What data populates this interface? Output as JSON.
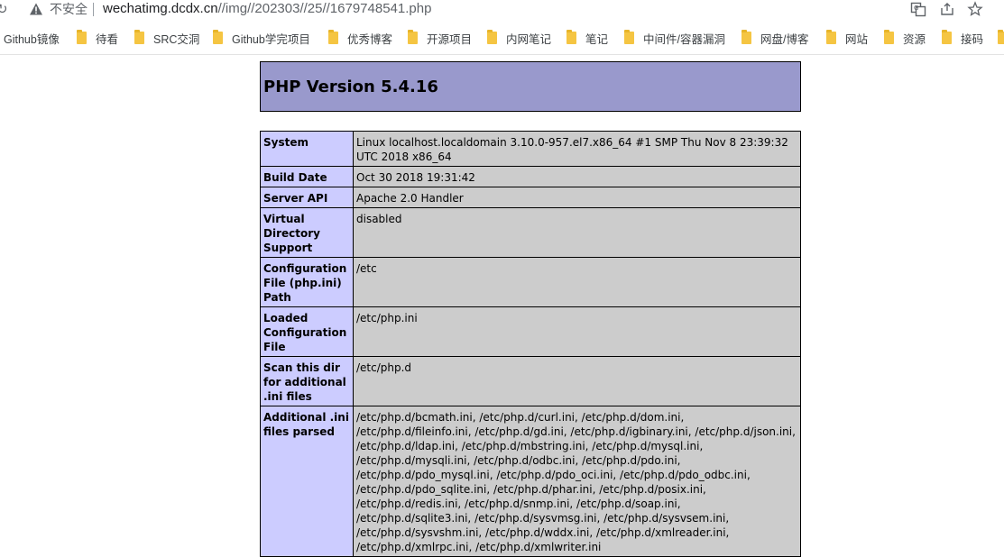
{
  "browser": {
    "insecure_label": "不安全",
    "url_host": "wechatimg.dcdx.cn",
    "url_path": "//img//202303//25//1679748541.php"
  },
  "bookmarks": [
    {
      "label": "Github镜像"
    },
    {
      "label": "待看"
    },
    {
      "label": "SRC交洞"
    },
    {
      "label": "Github学完项目"
    },
    {
      "label": "优秀博客"
    },
    {
      "label": "开源项目"
    },
    {
      "label": "内网笔记"
    },
    {
      "label": "笔记"
    },
    {
      "label": "中间件/容器漏洞"
    },
    {
      "label": "网盘/博客"
    },
    {
      "label": "网站"
    },
    {
      "label": "资源"
    },
    {
      "label": "接码"
    }
  ],
  "php": {
    "title": "PHP Version 5.4.16",
    "rows": [
      {
        "key": "System",
        "value": "Linux localhost.localdomain 3.10.0-957.el7.x86_64 #1 SMP Thu Nov 8 23:39:32 UTC 2018 x86_64"
      },
      {
        "key": "Build Date",
        "value": "Oct 30 2018 19:31:42"
      },
      {
        "key": "Server API",
        "value": "Apache 2.0 Handler"
      },
      {
        "key": "Virtual Directory Support",
        "value": "disabled"
      },
      {
        "key": "Configuration File (php.ini) Path",
        "value": "/etc"
      },
      {
        "key": "Loaded Configuration File",
        "value": "/etc/php.ini"
      },
      {
        "key": "Scan this dir for additional .ini files",
        "value": "/etc/php.d"
      },
      {
        "key": "Additional .ini files parsed",
        "value": "/etc/php.d/bcmath.ini, /etc/php.d/curl.ini, /etc/php.d/dom.ini, /etc/php.d/fileinfo.ini, /etc/php.d/gd.ini, /etc/php.d/igbinary.ini, /etc/php.d/json.ini, /etc/php.d/ldap.ini, /etc/php.d/mbstring.ini, /etc/php.d/mysql.ini, /etc/php.d/mysqli.ini, /etc/php.d/odbc.ini, /etc/php.d/pdo.ini, /etc/php.d/pdo_mysql.ini, /etc/php.d/pdo_oci.ini, /etc/php.d/pdo_odbc.ini, /etc/php.d/pdo_sqlite.ini, /etc/php.d/phar.ini, /etc/php.d/posix.ini, /etc/php.d/redis.ini, /etc/php.d/snmp.ini, /etc/php.d/soap.ini, /etc/php.d/sqlite3.ini, /etc/php.d/sysvmsg.ini, /etc/php.d/sysvsem.ini, /etc/php.d/sysvshm.ini, /etc/php.d/wddx.ini, /etc/php.d/xmlreader.ini, /etc/php.d/xmlrpc.ini, /etc/php.d/xmlwriter.ini"
      }
    ]
  },
  "colors": {
    "header_bg": "#9999cc",
    "key_bg": "#ccccff",
    "value_bg": "#cccccc"
  }
}
